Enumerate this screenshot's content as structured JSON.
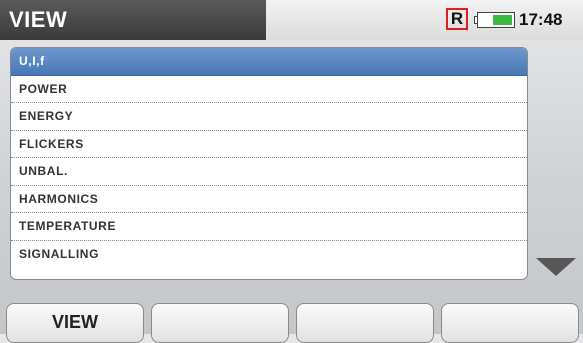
{
  "header": {
    "title": "VIEW",
    "recording_indicator": "R",
    "battery_level": 0.6,
    "time": "17:48"
  },
  "menu": {
    "items": [
      {
        "label": "U,I,f",
        "selected": true
      },
      {
        "label": "POWER",
        "selected": false
      },
      {
        "label": "ENERGY",
        "selected": false
      },
      {
        "label": "FLICKERS",
        "selected": false
      },
      {
        "label": "UNBAL.",
        "selected": false
      },
      {
        "label": "HARMONICS",
        "selected": false
      },
      {
        "label": "TEMPERATURE",
        "selected": false
      },
      {
        "label": "SIGNALLING",
        "selected": false
      }
    ]
  },
  "softkeys": [
    "VIEW",
    "",
    "",
    ""
  ],
  "colors": {
    "selected_row": "#4a78b7",
    "battery_fill": "#3db843",
    "record_border": "#e01e1e"
  }
}
